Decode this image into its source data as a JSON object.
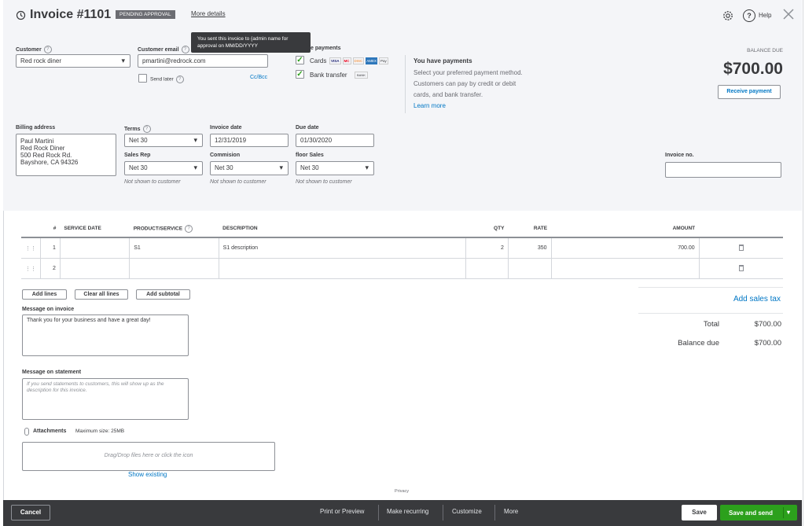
{
  "header": {
    "title": "Invoice #1101",
    "status": "PENDING APPROVAL",
    "more_details": "More details",
    "tooltip": "You sent this invoice to {admin name for approval on MM/DD/YYYY",
    "help": "Help"
  },
  "customer": {
    "label": "Customer",
    "value": "Red rock diner",
    "email_label": "Customer email",
    "email_value": "pmartini@redrock.com",
    "send_later": "Send later",
    "cc_bcc": "Cc/Bcc"
  },
  "payments": {
    "label": "e payments",
    "cards": "Cards",
    "card_badges": [
      "VISA",
      "MC",
      "DISC",
      "AMEX",
      "Pay"
    ],
    "bank": "Bank transfer",
    "bank_badge": "BANK",
    "info_title": "You have payments",
    "info_lines": [
      "Select your preferred payment method.",
      "Customers can pay by credit or debit",
      "cards, and bank transfer."
    ],
    "learn_more": "Learn more"
  },
  "balance": {
    "label": "BALANCE DUE",
    "amount": "$700.00",
    "receive_payment": "Receive payment"
  },
  "billing": {
    "label": "Billing address",
    "lines": [
      "Paul Martini",
      "Red Rock Diner",
      "500 Red Rock Rd.",
      "Bayshore, CA 94326"
    ]
  },
  "terms": {
    "label": "Terms",
    "value": "Net 30"
  },
  "invoice_date": {
    "label": "Invoice date",
    "value": "12/31/2019"
  },
  "due_date": {
    "label": "Due date",
    "value": "01/30/2020"
  },
  "sales_rep": {
    "label": "Sales Rep",
    "value": "Net 30",
    "note": "Not shown to customer"
  },
  "commission": {
    "label": "Commision",
    "value": "Net 30",
    "note": "Not shown to customer"
  },
  "floor_sales": {
    "label": "floor Sales",
    "value": "Net 30",
    "note": "Not shown to customer"
  },
  "invoice_no": {
    "label": "Invoice no.",
    "value": ""
  },
  "table": {
    "headers": [
      "#",
      "SERVICE DATE",
      "PRODUCT/SERVICE",
      "DESCRIPTION",
      "QTY",
      "RATE",
      "AMOUNT"
    ],
    "rows": [
      {
        "num": "1",
        "date": "",
        "product": "S1",
        "description": "S1 description",
        "qty": "2",
        "rate": "350",
        "amount": "700.00"
      },
      {
        "num": "2",
        "date": "",
        "product": "",
        "description": "",
        "qty": "",
        "rate": "",
        "amount": ""
      }
    ]
  },
  "line_actions": {
    "add_lines": "Add lines",
    "clear_all": "Clear all lines",
    "add_subtotal": "Add subtotal"
  },
  "message_invoice": {
    "label": "Message on invoice",
    "value": "Thank you for your business and have a great day!"
  },
  "message_statement": {
    "label": "Message on statement",
    "placeholder": "If you send statements to customers, this will show up as the description for this invoice."
  },
  "attachments": {
    "label": "Attachments",
    "max": "Maximum size: 25MB",
    "drop": "Drag/Drop files here or click the icon",
    "show_existing": "Show existing"
  },
  "totals": {
    "add_sales_tax": "Add sales tax",
    "total_label": "Total",
    "total_value": "$700.00",
    "balance_label": "Balance due",
    "balance_value": "$700.00"
  },
  "privacy": "Privacy",
  "footer": {
    "cancel": "Cancel",
    "print": "Print or Preview",
    "recurring": "Make recurring",
    "customize": "Customize",
    "more": "More",
    "save": "Save",
    "save_send": "Save and send"
  },
  "colors": {
    "primary_green": "#2ca01c",
    "link_blue": "#0077c5",
    "footer_bg": "#393a3d",
    "header_bg": "#f4f5f8"
  }
}
